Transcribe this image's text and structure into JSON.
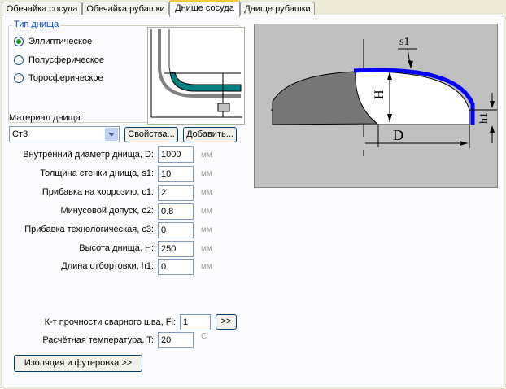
{
  "tabs": [
    {
      "label": "Обечайка сосуда",
      "active": false
    },
    {
      "label": "Обечайка рубашки",
      "active": false
    },
    {
      "label": "Днище сосуда",
      "active": true
    },
    {
      "label": "Днище рубашки",
      "active": false
    }
  ],
  "head_type": {
    "title": "Тип днища",
    "options": [
      {
        "label": "Эллиптическое",
        "checked": true
      },
      {
        "label": "Полусферическое",
        "checked": false
      },
      {
        "label": "Торосферическое",
        "checked": false
      }
    ]
  },
  "material": {
    "label": "Материал днища:",
    "value": "Ст3",
    "properties_button": "Свойства...",
    "add_button": "Добавить..."
  },
  "fields": [
    {
      "label": "Внутренний диаметр днища, D:",
      "value": "1000",
      "unit": "мм"
    },
    {
      "label": "Толщина стенки днища, s1:",
      "value": "10",
      "unit": "мм"
    },
    {
      "label": "Прибавка на коррозию, c1:",
      "value": "2",
      "unit": "мм"
    },
    {
      "label": "Минусовой допуск, c2:",
      "value": "0.8",
      "unit": "мм"
    },
    {
      "label": "Прибавка технологическая, c3:",
      "value": "0",
      "unit": "мм"
    },
    {
      "label": "Высота днища, H:",
      "value": "250",
      "unit": "мм"
    },
    {
      "label": "Длина отбортовки, h1:",
      "value": "0",
      "unit": "мм"
    }
  ],
  "weld": {
    "label": "К-т прочности сварного шва, Fi:",
    "value": "1",
    "button": ">>"
  },
  "temperature": {
    "label": "Расчётная температура, T:",
    "value": "20",
    "unit": "C"
  },
  "insulation_button": "Изоляция и футеровка >>",
  "drawing": {
    "label_s1": "s1",
    "label_H": "H",
    "label_D": "D",
    "label_h1": "h1"
  },
  "colors": {
    "accent_blue": "#0000ff",
    "jacket_teal": "#008080",
    "drawing_bg": "#c0c0c0",
    "tab_highlight": "#ffc83c"
  }
}
